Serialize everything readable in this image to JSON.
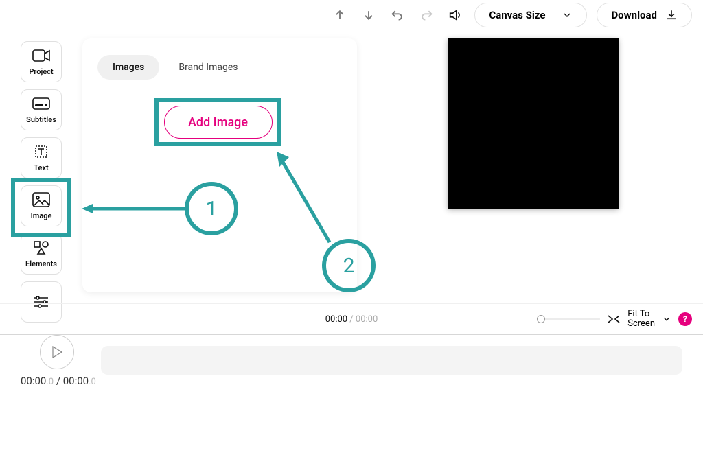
{
  "topbar": {
    "canvas_size_label": "Canvas Size",
    "download_label": "Download"
  },
  "nav": {
    "project": "Project",
    "subtitles": "Subtitles",
    "text": "Text",
    "image": "Image",
    "elements": "Elements"
  },
  "panel": {
    "tab_images": "Images",
    "tab_brand": "Brand Images",
    "add_image": "Add Image"
  },
  "annotations": {
    "step1": "1",
    "step2": "2"
  },
  "timebar": {
    "current": "00:00",
    "sep": " / ",
    "total": "00:00",
    "fit1": "Fit To",
    "fit2": "Screen",
    "help": "?"
  },
  "play": {
    "current": "00:00",
    "current_dec": ".0",
    "sep": " / ",
    "total": "00:00",
    "total_dec": ".0"
  }
}
